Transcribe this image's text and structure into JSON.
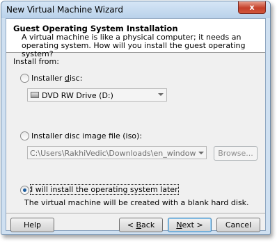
{
  "window": {
    "title": "New Virtual Machine Wizard",
    "close_symbol": "x"
  },
  "header": {
    "title": "Guest Operating System Installation",
    "description": "A virtual machine is like a physical computer; it needs an operating system. How will you install the guest operating system?"
  },
  "install_from_label": "Install from:",
  "options": {
    "installer_disc": {
      "label_pre": "Installer ",
      "label_key": "d",
      "label_post": "isc:",
      "selected": false,
      "drive_value": "DVD RW Drive (D:)"
    },
    "iso": {
      "label": "Installer disc image file (iso):",
      "selected": false,
      "path_value": "C:\\Users\\RakhiVedic\\Downloads\\en_windows_xp_prof",
      "browse_label": "Browse..."
    },
    "later": {
      "label": "I will install the operating system later",
      "selected": true,
      "note": "The virtual machine will be created with a blank hard disk."
    }
  },
  "buttons": {
    "help": "Help",
    "back_lt": "< ",
    "back_key": "B",
    "back_rest": "ack",
    "next_key": "N",
    "next_rest": "ext >",
    "cancel": "Cancel"
  },
  "colors": {
    "accent": "#1c5c9e",
    "title_bar": "#b9d1ea",
    "close_button": "#c5402a"
  }
}
